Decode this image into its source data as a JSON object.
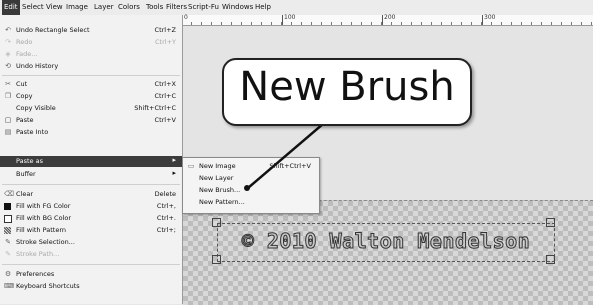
{
  "menubar": {
    "items": [
      "Edit",
      "Select",
      "View",
      "Image",
      "Layer",
      "Colors",
      "Tools",
      "Filters",
      "Script-Fu",
      "Windows",
      "Help"
    ]
  },
  "ruler": {
    "labels": [
      "0",
      "100",
      "200",
      "300"
    ]
  },
  "edit_menu": {
    "items": [
      {
        "label": "Undo Rectangle Select",
        "shortcut": "Ctrl+Z",
        "icon": "undo-icon"
      },
      {
        "label": "Redo",
        "shortcut": "Ctrl+Y",
        "icon": "redo-icon"
      },
      {
        "label": "Fade...",
        "shortcut": "",
        "icon": "fade-icon"
      },
      {
        "label": "Undo History",
        "shortcut": "",
        "icon": "undo-history-icon"
      },
      {
        "label": "Cut",
        "shortcut": "Ctrl+X",
        "icon": "scissors-icon"
      },
      {
        "label": "Copy",
        "shortcut": "Ctrl+C",
        "icon": "copy-icon"
      },
      {
        "label": "Copy Visible",
        "shortcut": "Shift+Ctrl+C",
        "icon": ""
      },
      {
        "label": "Paste",
        "shortcut": "Ctrl+V",
        "icon": "paste-icon"
      },
      {
        "label": "Paste Into",
        "shortcut": "",
        "icon": "paste-into-icon"
      },
      {
        "label": "Paste as",
        "shortcut": "",
        "icon": ""
      },
      {
        "label": "Buffer",
        "shortcut": "",
        "icon": ""
      },
      {
        "label": "Clear",
        "shortcut": "Delete",
        "icon": "eraser-icon"
      },
      {
        "label": "Fill with FG Color",
        "shortcut": "Ctrl+,",
        "icon": "fg-swatch-icon"
      },
      {
        "label": "Fill with BG Color",
        "shortcut": "Ctrl+.",
        "icon": "bg-swatch-icon"
      },
      {
        "label": "Fill with Pattern",
        "shortcut": "Ctrl+;",
        "icon": "pattern-icon"
      },
      {
        "label": "Stroke Selection...",
        "shortcut": "",
        "icon": "stroke-selection-icon"
      },
      {
        "label": "Stroke Path...",
        "shortcut": "",
        "icon": "stroke-path-icon"
      },
      {
        "label": "Preferences",
        "shortcut": "",
        "icon": "preferences-icon"
      },
      {
        "label": "Keyboard Shortcuts",
        "shortcut": "",
        "icon": "keyboard-icon"
      }
    ]
  },
  "paste_as_menu": {
    "items": [
      {
        "label": "New Image",
        "shortcut": "Shift+Ctrl+V"
      },
      {
        "label": "New Layer",
        "shortcut": ""
      },
      {
        "label": "New Brush...",
        "shortcut": ""
      },
      {
        "label": "New Pattern...",
        "shortcut": ""
      }
    ]
  },
  "callout": {
    "text": "New Brush"
  },
  "watermark": {
    "text": "© 2010 Walton Mendelson"
  },
  "colors": {
    "highlight": "#3c3c3c",
    "menu_bg": "#f2f2f2",
    "checker_dark": "#bdbdbd",
    "checker_light": "#d8d8d8"
  }
}
